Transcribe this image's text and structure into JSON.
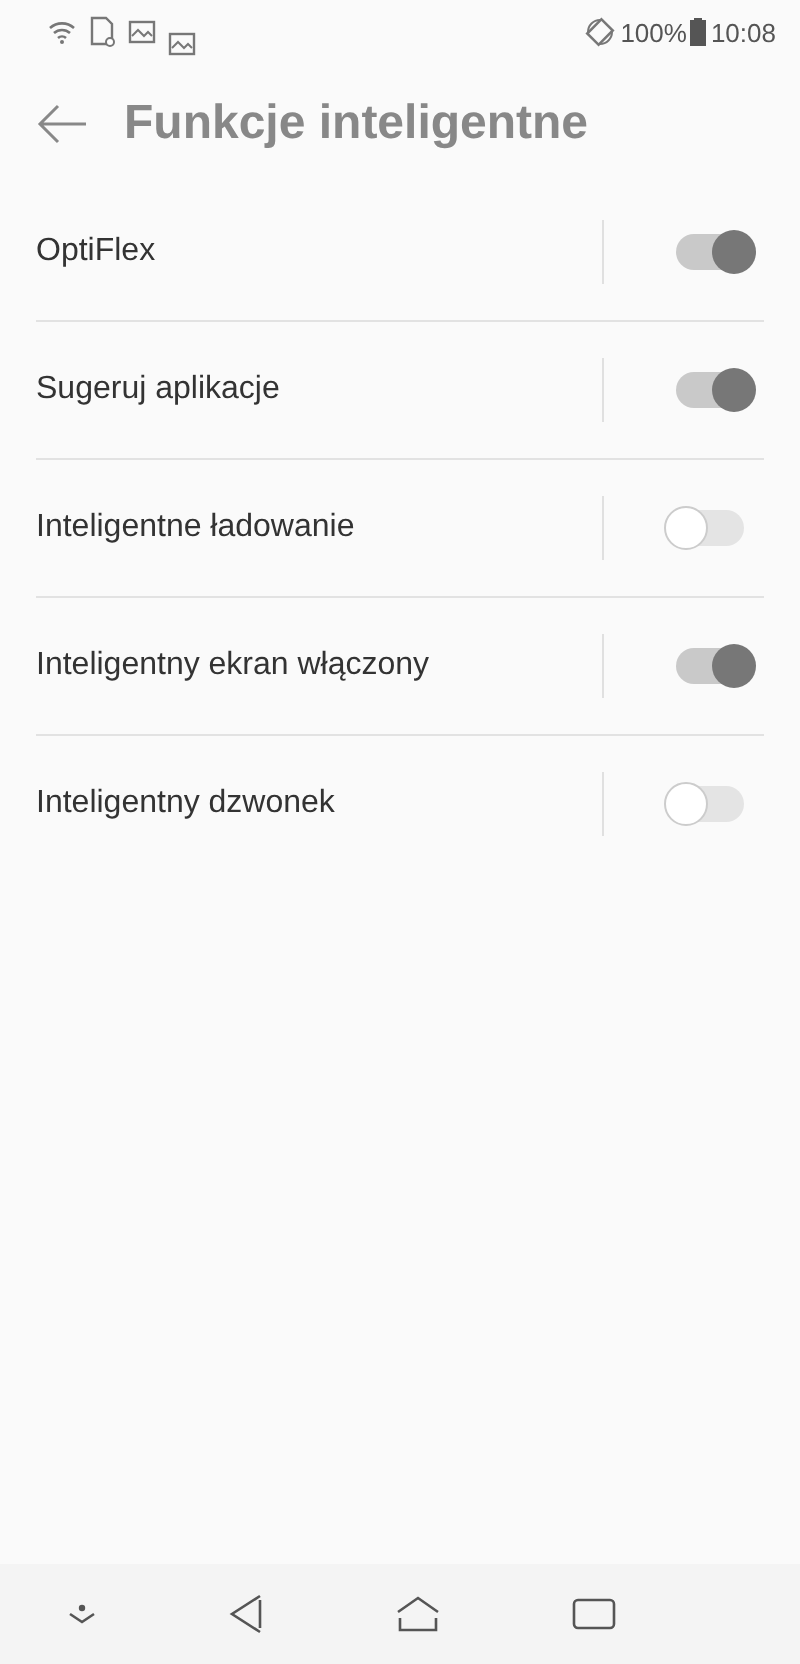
{
  "status_bar": {
    "battery": "100%",
    "time": "10:08"
  },
  "header": {
    "title": "Funkcje inteligentne"
  },
  "settings": [
    {
      "label": "OptiFlex",
      "on": true
    },
    {
      "label": "Sugeruj aplikacje",
      "on": true
    },
    {
      "label": "Inteligentne ładowanie",
      "on": false
    },
    {
      "label": "Inteligentny ekran włączony",
      "on": true
    },
    {
      "label": "Inteligentny dzwonek",
      "on": false
    }
  ]
}
